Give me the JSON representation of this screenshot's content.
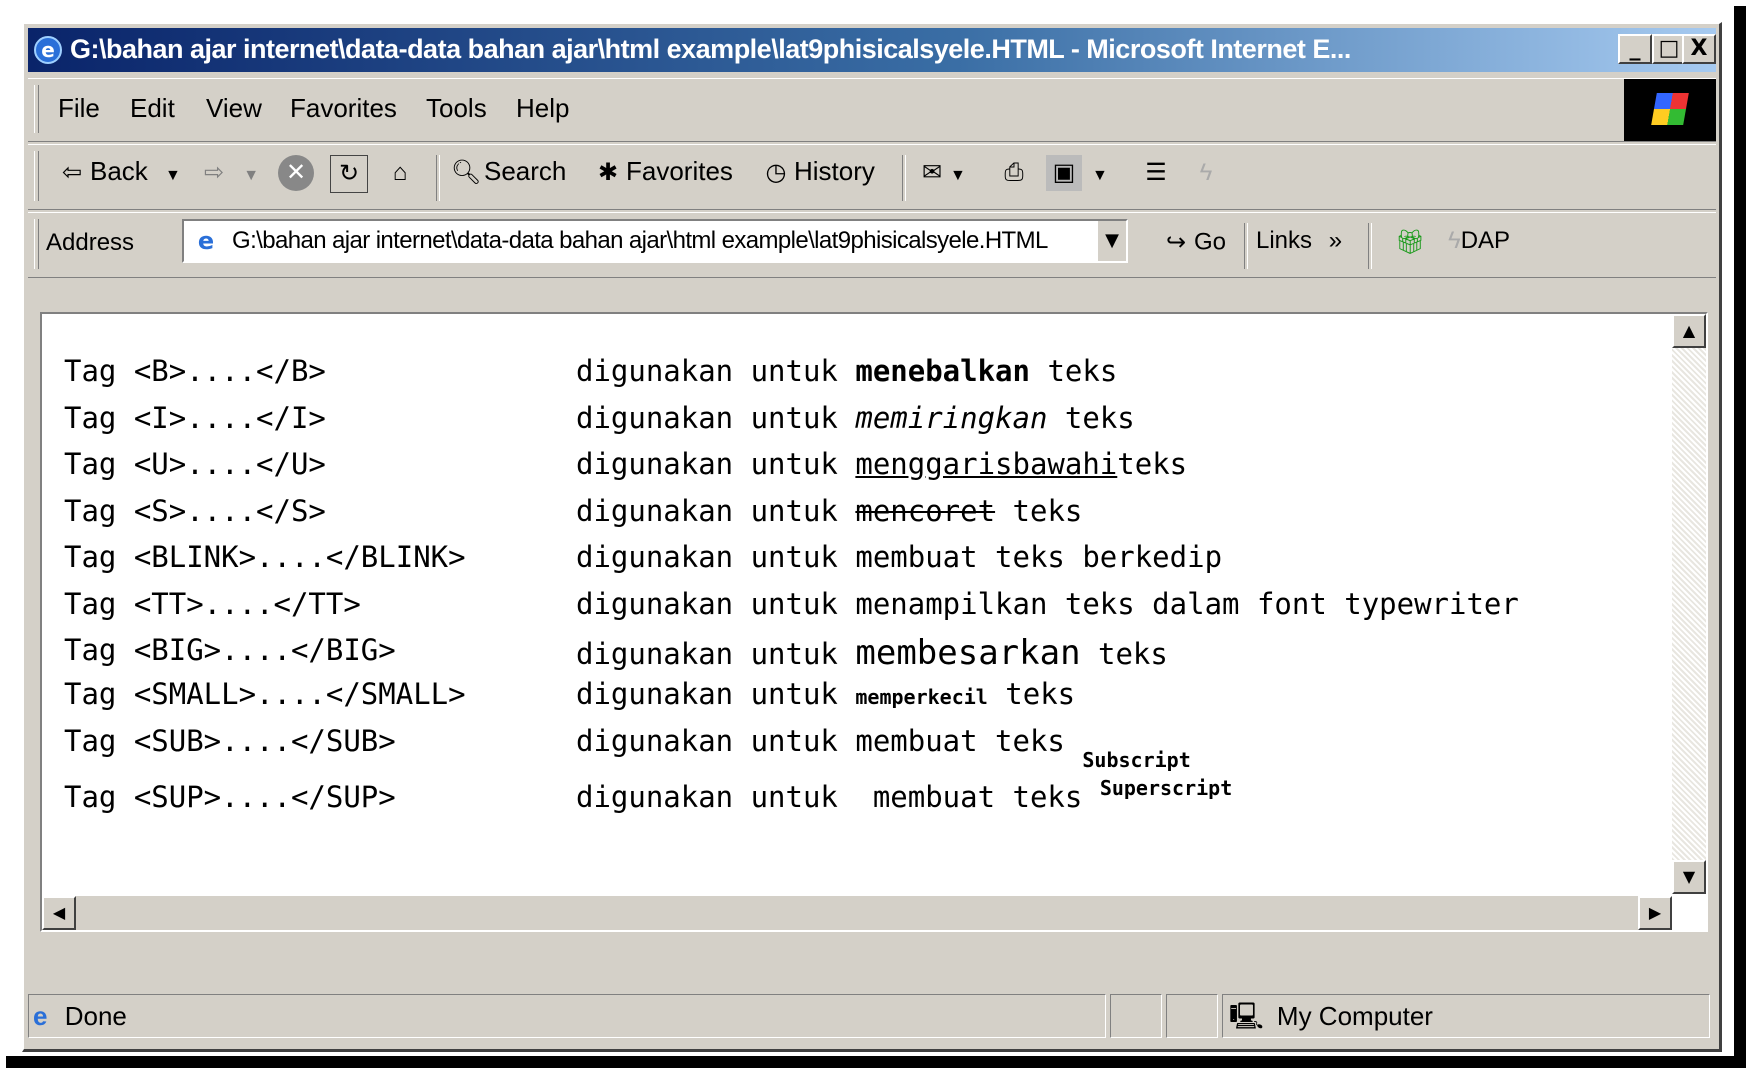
{
  "window": {
    "title": "G:\\bahan ajar internet\\data-data bahan ajar\\html example\\lat9phisicalsyele.HTML - Microsoft Internet E...",
    "controls": {
      "minimize": "_",
      "maximize": "□",
      "close": "X"
    }
  },
  "menu": [
    "File",
    "Edit",
    "View",
    "Favorites",
    "Tools",
    "Help"
  ],
  "toolbar": {
    "back": "Back",
    "search": "Search",
    "favorites": "Favorites",
    "history": "History"
  },
  "address": {
    "label": "Address",
    "value": "G:\\bahan ajar internet\\data-data bahan ajar\\html example\\lat9phisicalsyele.HTML",
    "go": "Go",
    "links": "Links",
    "links_more": "»",
    "dap": "DAP"
  },
  "content": {
    "verb": "digunakan untuk",
    "rows": [
      {
        "tag": "Tag <B>....</B>",
        "before": "",
        "styled": "menebalkan",
        "after": " teks"
      },
      {
        "tag": "Tag <I>....</I>",
        "before": "",
        "styled": "memiringkan",
        "after": " teks"
      },
      {
        "tag": "Tag <U>....</U>",
        "before": "",
        "styled": "menggarisbawahi",
        "after": "teks"
      },
      {
        "tag": "Tag <S>....</S>",
        "before": "",
        "styled": "mencoret",
        "after": " teks"
      },
      {
        "tag": "Tag <BLINK>....</BLINK>",
        "before": "membuat teks berkedip",
        "styled": "",
        "after": ""
      },
      {
        "tag": "Tag <TT>....</TT>",
        "before": "menampilkan teks dalam font typewriter",
        "styled": "",
        "after": ""
      },
      {
        "tag": "Tag <BIG>....</BIG>",
        "before": "",
        "styled": "membesarkan",
        "after": " teks"
      },
      {
        "tag": "Tag <SMALL>....</SMALL>",
        "before": "",
        "styled": "memperkecil",
        "after": " teks"
      },
      {
        "tag": "Tag <SUB>....</SUB>",
        "before": "membuat teks ",
        "styled": "Subscript",
        "after": ""
      },
      {
        "tag": "Tag <SUP>....</SUP>",
        "before": " membuat teks ",
        "styled": "Superscript",
        "after": ""
      }
    ]
  },
  "status": {
    "text": "Done",
    "zone": "My Computer"
  }
}
